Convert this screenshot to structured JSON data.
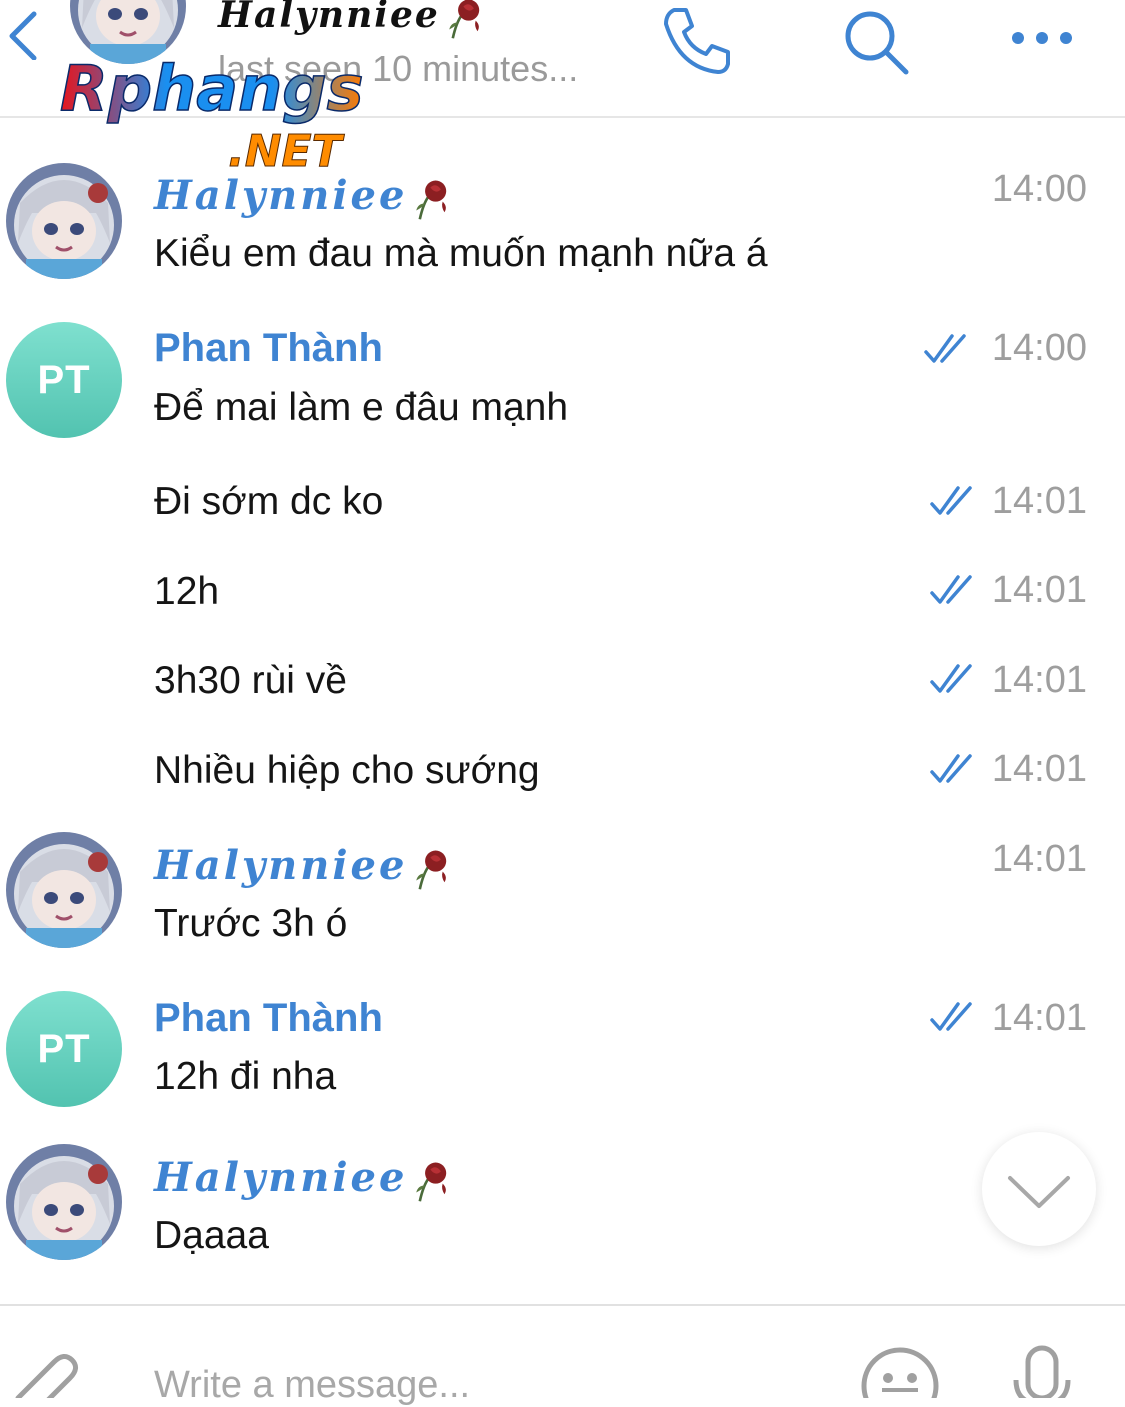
{
  "header": {
    "back_icon": "chevron-left-icon",
    "contact_name": "Halynniee",
    "status": "last seen 10 minutes...",
    "call_icon": "phone-icon",
    "search_icon": "search-icon",
    "more_icon": "ellipsis-icon",
    "accent": "#3f84d2"
  },
  "watermark": {
    "brand": "Rphangs",
    "domain": ".NET"
  },
  "messages": [
    {
      "sender": "Halynniee",
      "text": "Kiểu em đau mà muốn mạnh nữa á",
      "time": "14:00"
    },
    {
      "sender": "Phan Thành",
      "avatar_initials": "PT",
      "text": "Để mai làm e đâu mạnh",
      "time": "14:00",
      "read": true
    },
    {
      "text": "Đi sớm dc ko",
      "time": "14:01",
      "read": true
    },
    {
      "text": "12h",
      "time": "14:01",
      "read": true
    },
    {
      "text": "3h30 rùi về",
      "time": "14:01",
      "read": true
    },
    {
      "text": "Nhiều hiệp cho sướng",
      "time": "14:01",
      "read": true
    },
    {
      "sender": "Halynniee",
      "text": "Trước 3h ó",
      "time": "14:01"
    },
    {
      "sender": "Phan Thành",
      "avatar_initials": "PT",
      "text": "12h đi nha",
      "time": "14:01",
      "read": true
    },
    {
      "sender": "Halynniee",
      "text": "Dạaaa"
    }
  ],
  "scroll_down_icon": "chevron-down-icon",
  "composer": {
    "placeholder": "Write a message...",
    "attach_icon": "paperclip-icon",
    "sticker_icon": "smiley-icon",
    "voice_icon": "microphone-icon"
  }
}
